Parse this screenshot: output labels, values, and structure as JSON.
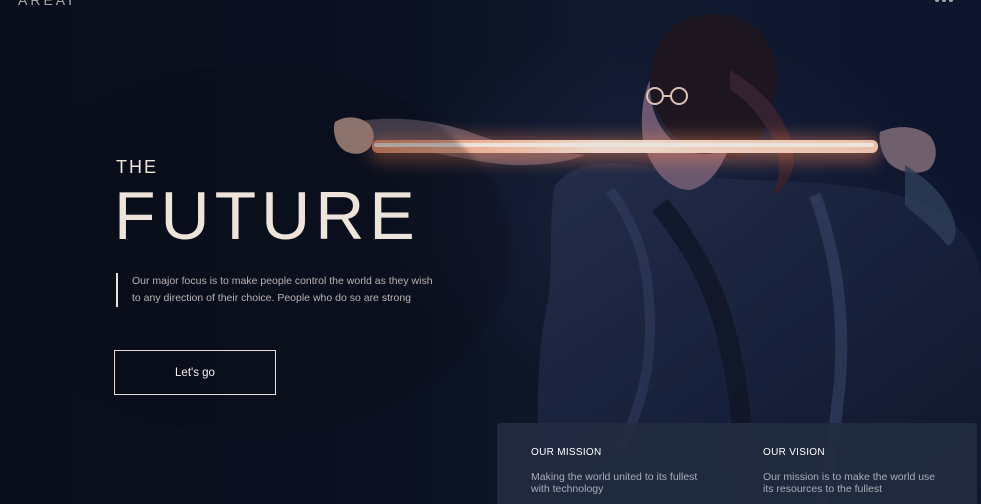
{
  "brand": {
    "logo_text": "AREAI"
  },
  "icons": {
    "menu": "menu-dots-icon"
  },
  "hero": {
    "overline": "THE",
    "title": "FUTURE",
    "tagline_line1": "Our major focus is to make people control the world as they wish",
    "tagline_line2": "to any direction of their choice. People who do so are strong",
    "cta_label": "Let's go"
  },
  "info": {
    "mission": {
      "title": "OUR MISSION",
      "text": "Making the world united to its fullest with technology"
    },
    "vision": {
      "title": "OUR VISION",
      "text": "Our mission is to make the world use its resources to the fullest"
    }
  },
  "colors": {
    "background": "#0b1020",
    "accent_glow": "#ff9b72",
    "text_primary": "#efe4db",
    "panel": "#222b40"
  }
}
